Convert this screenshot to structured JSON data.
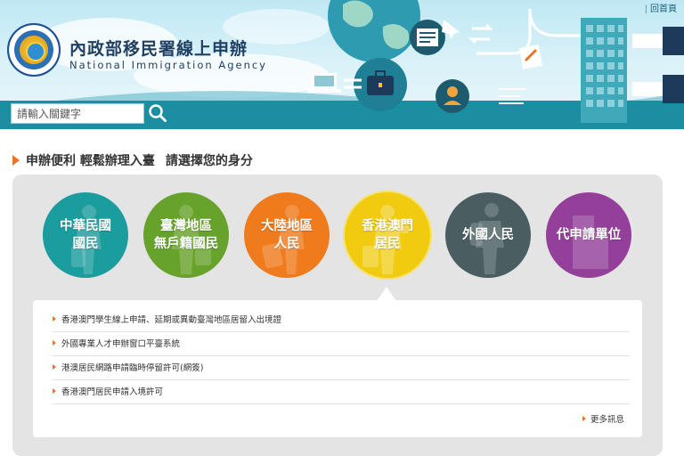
{
  "header": {
    "home_link": "回首頁",
    "title": "內政部移民署線上申辦",
    "subtitle": "National Immigration Agency",
    "search": {
      "placeholder": "請輸入關鍵字",
      "value": ""
    }
  },
  "section": {
    "title": "申辦便利 輕鬆辦理入臺",
    "subtitle": "請選擇您的身分"
  },
  "identities": [
    {
      "line1": "中華民國",
      "line2": "國民",
      "color": "#1b9c9d"
    },
    {
      "line1": "臺灣地區",
      "line2": "無戶籍國民",
      "color": "#67a32a"
    },
    {
      "line1": "大陸地區",
      "line2": "人民",
      "color": "#ef7b1d"
    },
    {
      "line1": "香港澳門",
      "line2": "居民",
      "color": "#f0cb10",
      "selected": true
    },
    {
      "line1": "外國人民",
      "line2": "",
      "color": "#4a5e62"
    },
    {
      "line1": "代申請單位",
      "line2": "",
      "color": "#94409b"
    }
  ],
  "list": {
    "items": [
      "香港澳門學生線上申請、延期或異動臺灣地區居留入出境證",
      "外國專業人才申辦窗口平臺系統",
      "港澳居民網路申請臨時停留許可(網簽)",
      "香港澳門居民申請入境許可"
    ],
    "more": "更多訊息"
  },
  "colors": {
    "accent": "#e8742a",
    "teal": "#1b8ea1"
  }
}
